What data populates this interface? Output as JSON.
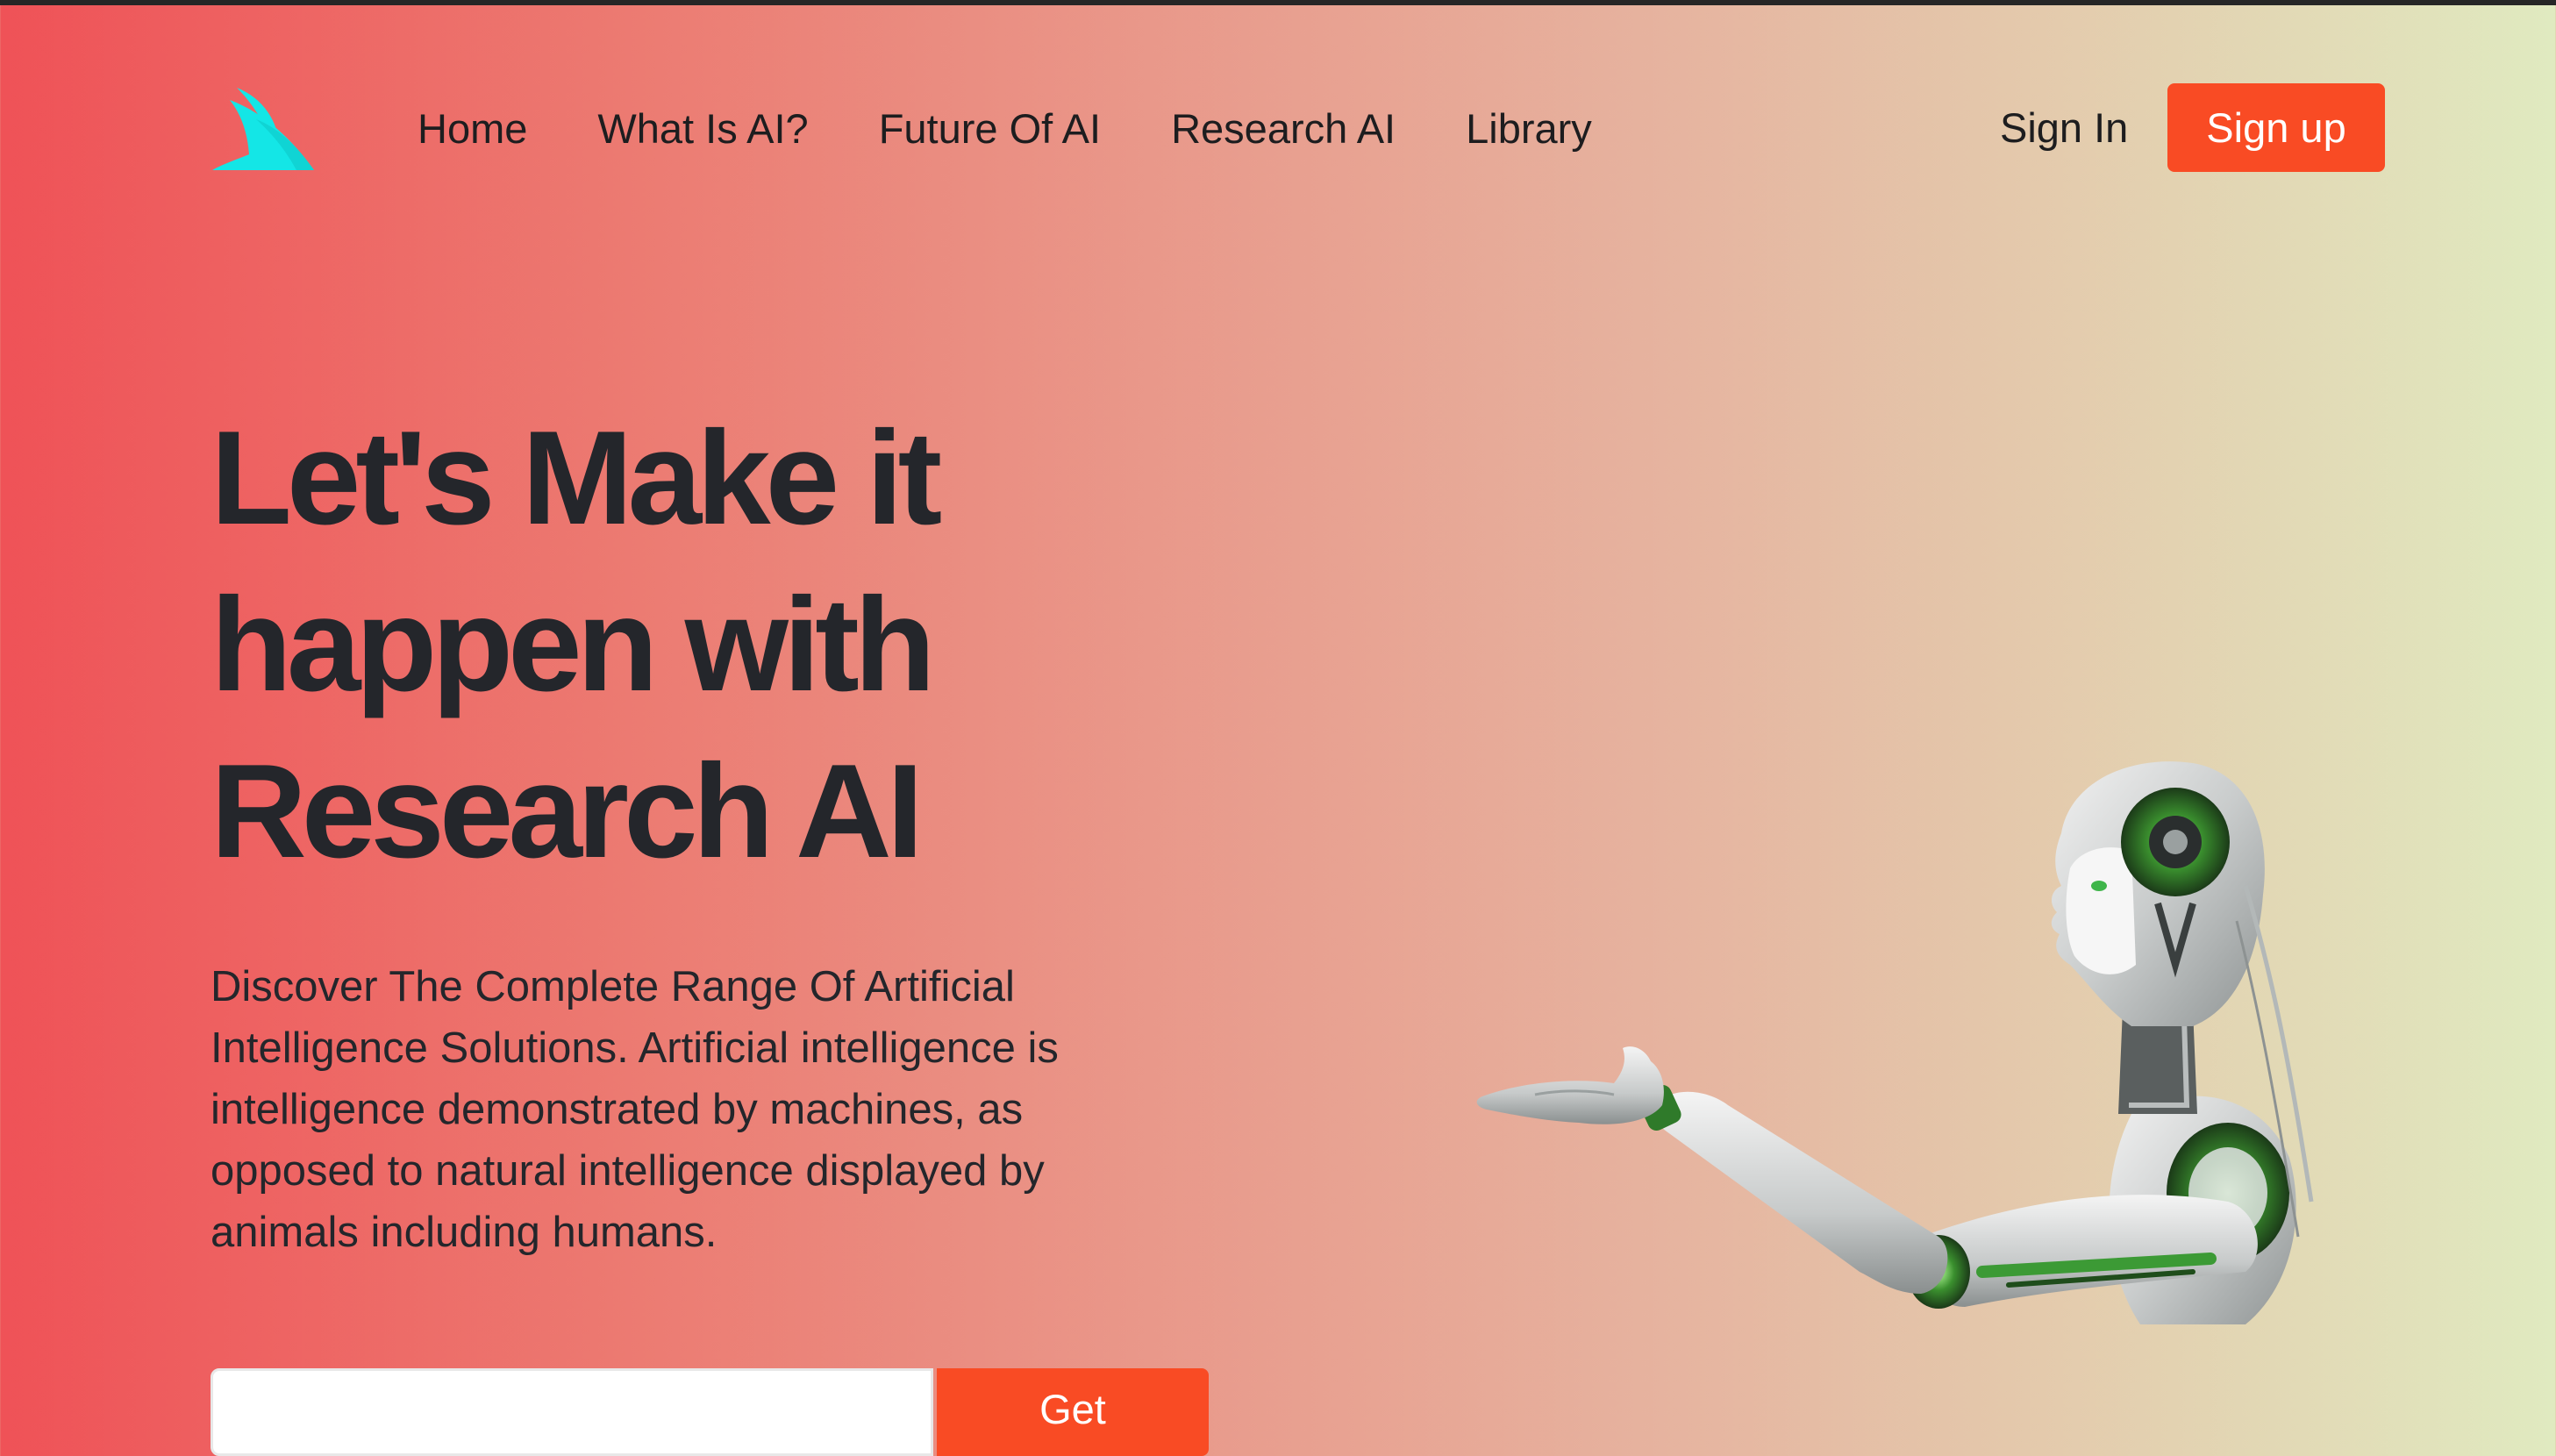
{
  "nav": {
    "logo": "shark-fin-logo",
    "links": [
      {
        "label": "Home"
      },
      {
        "label": "What Is AI?"
      },
      {
        "label": "Future Of AI"
      },
      {
        "label": "Research AI"
      },
      {
        "label": "Library"
      }
    ],
    "sign_in": "Sign In",
    "sign_up": "Sign up"
  },
  "hero": {
    "title_lines": [
      "Let's Make it",
      "happen with",
      "Research AI"
    ],
    "description_lines": [
      "Discover The Complete Range Of Artificial",
      "Intelligence Solutions. Artificial intelligence is",
      "intelligence demonstrated by machines, as",
      "opposed to natural intelligence displayed by",
      "animals including humans."
    ],
    "email_value": "",
    "get_button": "Get"
  },
  "colors": {
    "accent": "#f94b24",
    "logo": "#14e6e6",
    "text": "#24262b",
    "gradient_left": "#ef5257",
    "gradient_right": "#e0eac0"
  },
  "images": {
    "robot": "humanoid-robot-image"
  }
}
